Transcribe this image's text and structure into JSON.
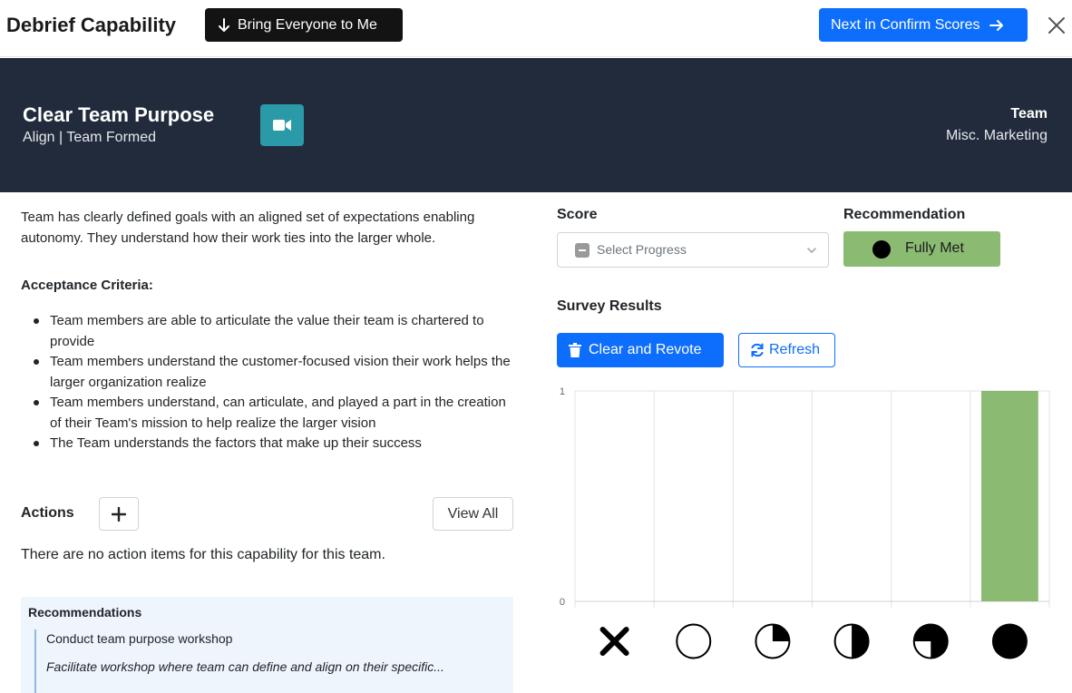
{
  "topbar": {
    "title": "Debrief Capability",
    "bring_everyone_label": "Bring Everyone to Me",
    "next_label": "Next in Confirm Scores"
  },
  "header": {
    "capability_title": "Clear Team Purpose",
    "capability_subtitle": "Align | Team Formed",
    "team_label": "Team",
    "team_value": "Misc. Marketing",
    "accent_color": "#222b3c",
    "video_button_color": "#2a9aa8"
  },
  "details": {
    "description": "Team has clearly defined goals with an aligned set of expectations enabling autonomy. They understand how their work ties into the larger whole.",
    "criteria_heading": "Acceptance Criteria:",
    "criteria": [
      "Team members are able to articulate the value their team is chartered to provide",
      "Team members understand the customer-focused vision their work helps the larger organization realize",
      "Team members understand, can articulate, and played a part in the creation of their Team's mission to help realize the larger vision",
      "The Team understands the factors that make up their success"
    ]
  },
  "actions": {
    "label": "Actions",
    "view_all_label": "View All",
    "empty_message": "There are no action items for this capability for this team."
  },
  "recommendations": {
    "title": "Recommendations",
    "items": [
      {
        "title": "Conduct team purpose workshop",
        "description": "Facilitate workshop where team can define and align on their specific..."
      }
    ]
  },
  "score": {
    "label": "Score",
    "placeholder": "Select Progress"
  },
  "recommendation": {
    "label": "Recommendation",
    "value": "Fully Met",
    "color": "#8bbb72"
  },
  "survey": {
    "label": "Survey Results",
    "clear_label": "Clear and Revote",
    "refresh_label": "Refresh"
  },
  "chart_data": {
    "type": "bar",
    "categories": [
      "not-applicable",
      "not-met",
      "partially-met-quarter",
      "half-met",
      "mostly-met",
      "fully-met"
    ],
    "category_icons": [
      "x-icon",
      "empty-circle-icon",
      "quarter-circle-icon",
      "half-circle-icon",
      "three-quarter-circle-icon",
      "full-circle-icon"
    ],
    "values": [
      0,
      0,
      0,
      0,
      0,
      1
    ],
    "ylim": [
      0,
      1
    ],
    "yticks": [
      "0",
      "1"
    ],
    "bar_color": "#8bbb72",
    "grid": true
  }
}
